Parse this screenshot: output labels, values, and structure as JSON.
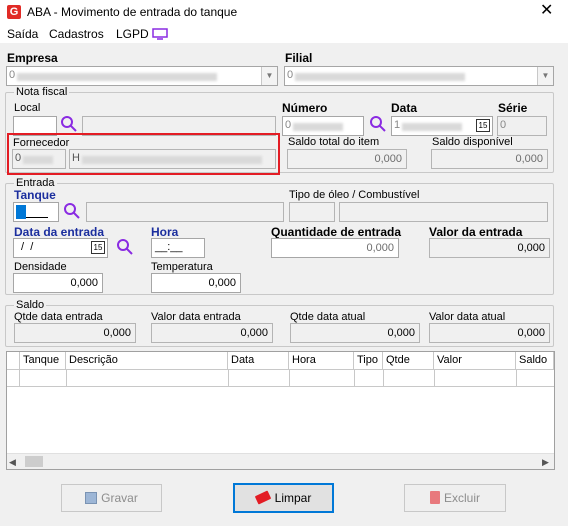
{
  "window": {
    "title": "ABA - Movimento de entrada do tanque",
    "icon": "app-logo-icon"
  },
  "menu": [
    {
      "label": "Saída"
    },
    {
      "label": "Cadastros"
    },
    {
      "label": "LGPD"
    }
  ],
  "empresa": {
    "label": "Empresa",
    "value": "0"
  },
  "filial": {
    "label": "Filial",
    "value": "0"
  },
  "nota_fiscal": {
    "title": "Nota fiscal",
    "local_label": "Local",
    "numero_label": "Número",
    "numero_value": "0",
    "data_label": "Data",
    "data_value": "1",
    "serie_label": "Série",
    "serie_value": "0",
    "fornecedor_label": "Fornecedor",
    "fornecedor_code": "0",
    "fornecedor_name": "H",
    "saldo_total_label": "Saldo total do item",
    "saldo_total_value": "0,000",
    "saldo_disponivel_label": "Saldo disponível",
    "saldo_disponivel_value": "0,000"
  },
  "entrada": {
    "title": "Entrada",
    "tanque_label": "Tanque",
    "tipo_oleo_label": "Tipo de óleo / Combustível",
    "data_entrada_label": "Data da entrada",
    "data_entrada_value": " /  /",
    "hora_label": "Hora",
    "hora_value": "__:__",
    "quantidade_label": "Quantidade de entrada",
    "quantidade_value": "0,000",
    "valor_label": "Valor da entrada",
    "valor_value": "0,000",
    "densidade_label": "Densidade",
    "densidade_value": "0,000",
    "temperatura_label": "Temperatura",
    "temperatura_value": "0,000"
  },
  "saldo": {
    "title": "Saldo",
    "qtde_data_entrada_label": "Qtde data entrada",
    "qtde_data_entrada_value": "0,000",
    "valor_data_entrada_label": "Valor data entrada",
    "valor_data_entrada_value": "0,000",
    "qtde_data_atual_label": "Qtde data atual",
    "qtde_data_atual_value": "0,000",
    "valor_data_atual_label": "Valor data atual",
    "valor_data_atual_value": "0,000"
  },
  "grid": {
    "columns": [
      "Tanque",
      "Descrição",
      "Data",
      "Hora",
      "Tipo",
      "Qtde",
      "Valor",
      "Saldo"
    ]
  },
  "buttons": {
    "gravar": "Gravar",
    "limpar": "Limpar",
    "excluir": "Excluir"
  },
  "colors": {
    "accent_label": "#1b2e9e",
    "highlight": "#e31c24",
    "search_icon": "#8a2be2"
  }
}
